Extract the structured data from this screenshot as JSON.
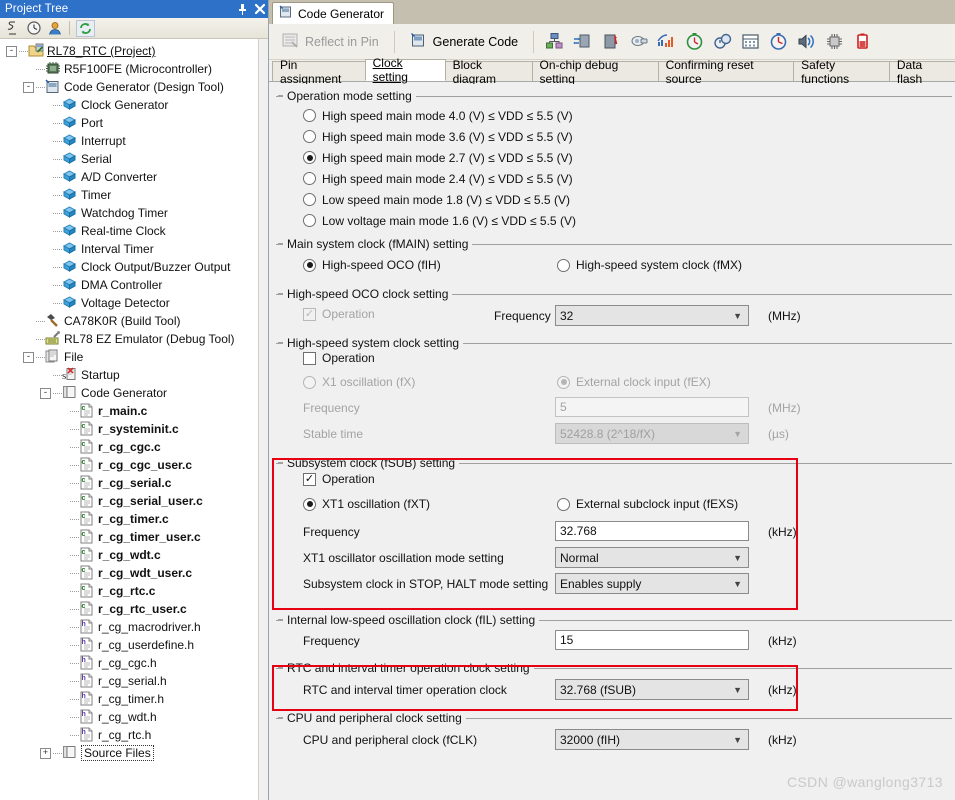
{
  "tree_panel": {
    "title": "Project Tree",
    "pin_icon": "pin-icon",
    "close_icon": "close-icon",
    "toolbar": [
      {
        "name": "property-icon",
        "glyph": "§"
      },
      {
        "name": "clock-icon",
        "glyph": "◔"
      },
      {
        "name": "user-icon",
        "glyph": "●"
      },
      {
        "name": "refresh-icon",
        "glyph": "↻"
      }
    ],
    "nodes": [
      {
        "label": "RL78_RTC (Project)",
        "depth": 0,
        "expander": "-",
        "icon": "project-icon",
        "style": "underline"
      },
      {
        "label": "R5F100FE (Microcontroller)",
        "depth": 1,
        "expander": "",
        "icon": "chip-icon",
        "style": ""
      },
      {
        "label": "Code Generator (Design Tool)",
        "depth": 1,
        "expander": "-",
        "icon": "codegen-icon",
        "style": ""
      },
      {
        "label": "Clock Generator",
        "depth": 2,
        "expander": "",
        "icon": "cube-blue-icon",
        "style": ""
      },
      {
        "label": "Port",
        "depth": 2,
        "expander": "",
        "icon": "cube-blue-icon",
        "style": ""
      },
      {
        "label": "Interrupt",
        "depth": 2,
        "expander": "",
        "icon": "cube-blue-icon",
        "style": ""
      },
      {
        "label": "Serial",
        "depth": 2,
        "expander": "",
        "icon": "cube-blue-icon",
        "style": ""
      },
      {
        "label": "A/D Converter",
        "depth": 2,
        "expander": "",
        "icon": "cube-blue-icon",
        "style": ""
      },
      {
        "label": "Timer",
        "depth": 2,
        "expander": "",
        "icon": "cube-blue-icon",
        "style": ""
      },
      {
        "label": "Watchdog Timer",
        "depth": 2,
        "expander": "",
        "icon": "cube-blue-icon",
        "style": ""
      },
      {
        "label": "Real-time Clock",
        "depth": 2,
        "expander": "",
        "icon": "cube-blue-icon",
        "style": ""
      },
      {
        "label": "Interval Timer",
        "depth": 2,
        "expander": "",
        "icon": "cube-blue-icon",
        "style": ""
      },
      {
        "label": "Clock Output/Buzzer Output",
        "depth": 2,
        "expander": "",
        "icon": "cube-blue-icon",
        "style": ""
      },
      {
        "label": "DMA Controller",
        "depth": 2,
        "expander": "",
        "icon": "cube-blue-icon",
        "style": ""
      },
      {
        "label": "Voltage Detector",
        "depth": 2,
        "expander": "",
        "icon": "cube-blue-icon",
        "style": ""
      },
      {
        "label": "CA78K0R (Build Tool)",
        "depth": 1,
        "expander": "",
        "icon": "hammer-icon",
        "style": ""
      },
      {
        "label": "RL78 EZ Emulator (Debug Tool)",
        "depth": 1,
        "expander": "",
        "icon": "emulator-icon",
        "style": ""
      },
      {
        "label": "File",
        "depth": 1,
        "expander": "-",
        "icon": "folder-file-icon",
        "style": ""
      },
      {
        "label": "Startup",
        "depth": 2,
        "expander": "",
        "icon": "startup-icon",
        "style": ""
      },
      {
        "label": "Code Generator",
        "depth": 2,
        "expander": "-",
        "icon": "folder-icon",
        "style": ""
      },
      {
        "label": "r_main.c",
        "depth": 3,
        "expander": "",
        "icon": "c-file-icon",
        "style": "bold"
      },
      {
        "label": "r_systeminit.c",
        "depth": 3,
        "expander": "",
        "icon": "c-file-icon",
        "style": "bold"
      },
      {
        "label": "r_cg_cgc.c",
        "depth": 3,
        "expander": "",
        "icon": "c-file-icon",
        "style": "bold"
      },
      {
        "label": "r_cg_cgc_user.c",
        "depth": 3,
        "expander": "",
        "icon": "c-file-icon",
        "style": "bold"
      },
      {
        "label": "r_cg_serial.c",
        "depth": 3,
        "expander": "",
        "icon": "c-file-icon",
        "style": "bold"
      },
      {
        "label": "r_cg_serial_user.c",
        "depth": 3,
        "expander": "",
        "icon": "c-file-icon",
        "style": "bold"
      },
      {
        "label": "r_cg_timer.c",
        "depth": 3,
        "expander": "",
        "icon": "c-file-icon",
        "style": "bold"
      },
      {
        "label": "r_cg_timer_user.c",
        "depth": 3,
        "expander": "",
        "icon": "c-file-icon",
        "style": "bold"
      },
      {
        "label": "r_cg_wdt.c",
        "depth": 3,
        "expander": "",
        "icon": "c-file-icon",
        "style": "bold"
      },
      {
        "label": "r_cg_wdt_user.c",
        "depth": 3,
        "expander": "",
        "icon": "c-file-icon",
        "style": "bold"
      },
      {
        "label": "r_cg_rtc.c",
        "depth": 3,
        "expander": "",
        "icon": "c-file-icon",
        "style": "bold"
      },
      {
        "label": "r_cg_rtc_user.c",
        "depth": 3,
        "expander": "",
        "icon": "c-file-icon",
        "style": "bold"
      },
      {
        "label": "r_cg_macrodriver.h",
        "depth": 3,
        "expander": "",
        "icon": "h-file-icon",
        "style": ""
      },
      {
        "label": "r_cg_userdefine.h",
        "depth": 3,
        "expander": "",
        "icon": "h-file-icon",
        "style": ""
      },
      {
        "label": "r_cg_cgc.h",
        "depth": 3,
        "expander": "",
        "icon": "h-file-icon",
        "style": ""
      },
      {
        "label": "r_cg_serial.h",
        "depth": 3,
        "expander": "",
        "icon": "h-file-icon",
        "style": ""
      },
      {
        "label": "r_cg_timer.h",
        "depth": 3,
        "expander": "",
        "icon": "h-file-icon",
        "style": ""
      },
      {
        "label": "r_cg_wdt.h",
        "depth": 3,
        "expander": "",
        "icon": "h-file-icon",
        "style": ""
      },
      {
        "label": "r_cg_rtc.h",
        "depth": 3,
        "expander": "",
        "icon": "h-file-icon",
        "style": ""
      },
      {
        "label": "Source Files",
        "depth": 2,
        "expander": "+",
        "icon": "folder-icon",
        "style": "dotted"
      }
    ]
  },
  "code_generator": {
    "tab_label": "Code Generator",
    "toolbar": {
      "reflect_in_pin": "Reflect in Pin",
      "generate_code": "Generate Code",
      "icons": [
        "port-icon",
        "interrupt-icon",
        "serial-icon",
        "ad-converter-icon",
        "timer-icon",
        "watchdog-icon",
        "realtime-clock-icon",
        "interval-timer-icon",
        "clock-output-icon",
        "buzzer-icon",
        "dma-icon",
        "voltage-detector-icon"
      ]
    },
    "subtabs": [
      {
        "label": "Pin assignment",
        "active": false
      },
      {
        "label": "Clock setting",
        "active": true
      },
      {
        "label": "Block diagram",
        "active": false
      },
      {
        "label": "On-chip debug setting",
        "active": false
      },
      {
        "label": "Confirming reset source",
        "active": false
      },
      {
        "label": "Safety functions",
        "active": false
      },
      {
        "label": "Data flash",
        "active": false
      }
    ]
  },
  "clock_setting": {
    "operation_mode": {
      "title": "Operation mode setting",
      "options": [
        {
          "label": "High speed main mode 4.0 (V) ≤ VDD ≤ 5.5 (V)",
          "selected": false
        },
        {
          "label": "High speed main mode 3.6 (V) ≤ VDD ≤ 5.5 (V)",
          "selected": false
        },
        {
          "label": "High speed main mode 2.7 (V) ≤ VDD ≤ 5.5 (V)",
          "selected": true
        },
        {
          "label": "High speed main mode 2.4 (V) ≤ VDD ≤ 5.5 (V)",
          "selected": false
        },
        {
          "label": "Low speed main mode 1.8 (V) ≤ VDD ≤ 5.5 (V)",
          "selected": false
        },
        {
          "label": "Low voltage main mode 1.6 (V) ≤ VDD ≤ 5.5 (V)",
          "selected": false
        }
      ]
    },
    "main_system_clock": {
      "title": "Main system clock (fMAIN) setting",
      "option_oco": "High-speed OCO (fIH)",
      "option_oco_selected": true,
      "option_mx": "High-speed system clock (fMX)",
      "option_mx_selected": false
    },
    "hs_oco": {
      "title": "High-speed OCO clock setting",
      "operation_label": "Operation",
      "operation_checked": true,
      "operation_disabled": true,
      "frequency_label": "Frequency",
      "frequency_value": "32",
      "frequency_unit": "(MHz)"
    },
    "hs_system": {
      "title": "High-speed system clock setting",
      "operation_label": "Operation",
      "operation_checked": false,
      "option_x1": "X1 oscillation (fX)",
      "option_x1_selected": false,
      "option_ex": "External clock input (fEX)",
      "option_ex_selected": true,
      "frequency_label": "Frequency",
      "frequency_value": "5",
      "frequency_unit": "(MHz)",
      "stable_label": "Stable time",
      "stable_value": "52428.8 (2^18/fX)",
      "stable_unit": "(µs)"
    },
    "subsystem": {
      "title": "Subsystem clock (fSUB) setting",
      "highlighted": true,
      "operation_label": "Operation",
      "operation_checked": true,
      "option_xt1": "XT1 oscillation (fXT)",
      "option_xt1_selected": true,
      "option_fexs": "External subclock input (fEXS)",
      "option_fexs_selected": false,
      "frequency_label": "Frequency",
      "frequency_value": "32.768",
      "frequency_unit": "(kHz)",
      "osc_mode_label": "XT1 oscillator oscillation mode setting",
      "osc_mode_value": "Normal",
      "stop_halt_label": "Subsystem clock in STOP, HALT mode setting",
      "stop_halt_value": "Enables supply"
    },
    "low_speed": {
      "title": "Internal low-speed oscillation clock (fIL) setting",
      "frequency_label": "Frequency",
      "frequency_value": "15",
      "frequency_unit": "(kHz)"
    },
    "rtc_interval": {
      "title": "RTC and interval timer operation clock setting",
      "highlighted": true,
      "clock_label": "RTC and interval timer operation clock",
      "clock_value": "32.768 (fSUB)",
      "clock_unit": "(kHz)"
    },
    "cpu_peripheral": {
      "title": "CPU and peripheral clock setting",
      "clock_label": "CPU and peripheral clock (fCLK)",
      "clock_value": "32000 (fIH)",
      "clock_unit": "(kHz)"
    }
  },
  "watermark": "CSDN @wanglong3713",
  "colors": {
    "titlebar": "#2e71c9",
    "highlight_red": "#e60012",
    "panel_bg": "#f0f0f0",
    "tab_strip": "#c4bfae"
  }
}
